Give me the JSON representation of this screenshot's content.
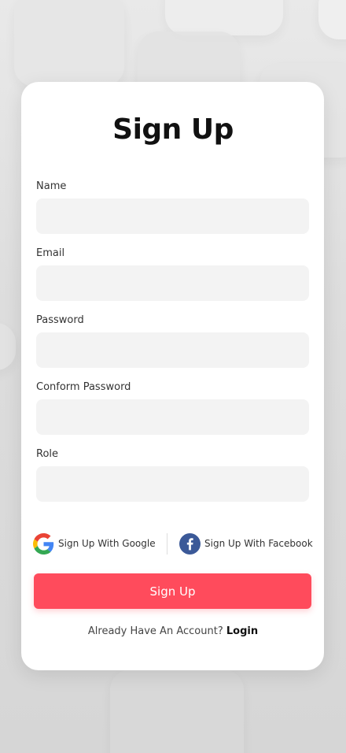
{
  "page": {
    "title": "Sign Up"
  },
  "form": {
    "fields": [
      {
        "label": "Name",
        "value": "",
        "placeholder": ""
      },
      {
        "label": "Email",
        "value": "",
        "placeholder": ""
      },
      {
        "label": "Password",
        "value": "",
        "placeholder": ""
      },
      {
        "label": "Conform Password",
        "value": "",
        "placeholder": ""
      },
      {
        "label": "Role",
        "value": "",
        "placeholder": ""
      }
    ]
  },
  "social": {
    "google_label": "Sign Up With Google",
    "facebook_label": "Sign Up With Facebook"
  },
  "submit_label": "Sign Up",
  "footer": {
    "prompt": "Already Have An Account?",
    "login_label": "Login"
  },
  "colors": {
    "accent": "#ff4b5c",
    "facebook": "#3b5998",
    "input_bg": "#f3f3f3"
  },
  "icons": [
    "google-icon",
    "facebook-icon"
  ]
}
